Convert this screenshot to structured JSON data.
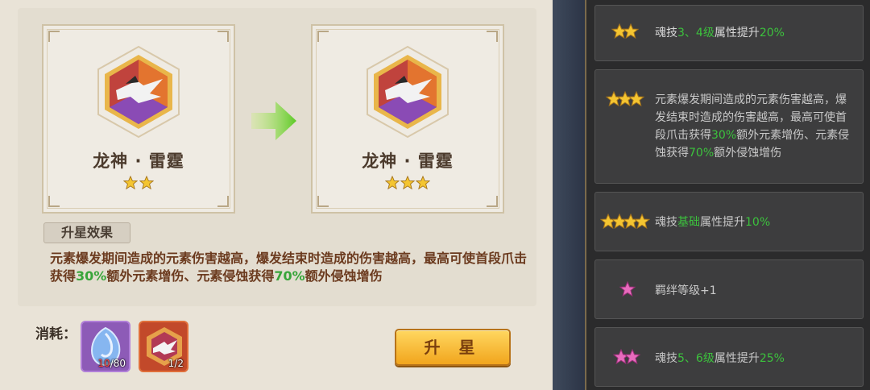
{
  "cards": {
    "before": {
      "name": "龙神 · 雷霆",
      "stars": 2
    },
    "after": {
      "name": "龙神 · 雷霆",
      "stars": 3
    }
  },
  "effect": {
    "tag": "升星效果",
    "text_parts": [
      "元素爆发期间造成的元素伤害越高，爆发结束时造成的伤害越高",
      "，最高可使首段爪击获得",
      "30%",
      "额外元素增伤、元素侵蚀获得",
      "70%",
      "额外侵蚀增伤"
    ]
  },
  "cost": {
    "label": "消耗：",
    "items": [
      {
        "icon": "blue-crystal-icon",
        "have": "10",
        "need": "/80"
      },
      {
        "icon": "dragon-emblem-icon",
        "have": "1",
        "need": "/2"
      }
    ]
  },
  "upgrade_button": {
    "label": "升 星"
  },
  "star_list": [
    {
      "stars": 2,
      "type": "gold",
      "parts": [
        "魂技",
        "3、4级",
        "属性提升",
        "20%"
      ]
    },
    {
      "stars": 3,
      "type": "gold",
      "parts": [
        "元素爆发期间造成的元素伤害越高，爆发结束时造成的伤害越高，最高可使首段爪击获得",
        "30%",
        "额外元素增伤、元素侵蚀获得",
        "70%",
        "额外侵蚀增伤"
      ]
    },
    {
      "stars": 4,
      "type": "gold",
      "parts": [
        "魂技",
        "基础",
        "属性提升",
        "10%"
      ]
    },
    {
      "stars": 1,
      "type": "pink",
      "parts": [
        "羁绊等级+1"
      ]
    },
    {
      "stars": 2,
      "type": "pink",
      "parts": [
        "魂技",
        "5、6级",
        "属性提升",
        "25%"
      ]
    }
  ],
  "colors": {
    "highlight_green": "#38a53a",
    "button_gold": "#f1a51d",
    "gold_star": "#f4c531",
    "pink_star": "#e86bbd"
  }
}
